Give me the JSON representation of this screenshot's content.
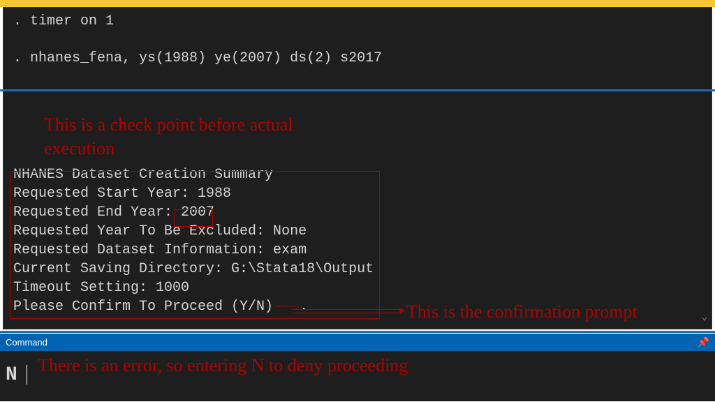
{
  "terminal": {
    "line1": ". timer on 1",
    "line2": ". nhanes_fena, ys(1988) ye(2007) ds(2) s2017",
    "summary_title": "NHANES Dataset Creation Summary",
    "start_year_label": "Requested Start Year: ",
    "start_year_val": "1988",
    "end_year_label": "Requested End Year: ",
    "end_year_val": "2007",
    "excluded": "Requested Year To Be Excluded: None",
    "dataset_info": "Requested Dataset Information: exam",
    "saving_dir": "Current Saving Directory: G:\\Stata18\\Output",
    "timeout": "Timeout Setting: 1000",
    "confirm": "Please Confirm To Proceed (Y/N)",
    "confirm_dot": "."
  },
  "annotations": {
    "checkpoint": "This is a check point before actual execution",
    "confirmation": "This is the confirmation prompt",
    "deny": "There is an error, so entering N to deny proceeding"
  },
  "command_bar": {
    "label": "Command",
    "input_value": "N"
  }
}
